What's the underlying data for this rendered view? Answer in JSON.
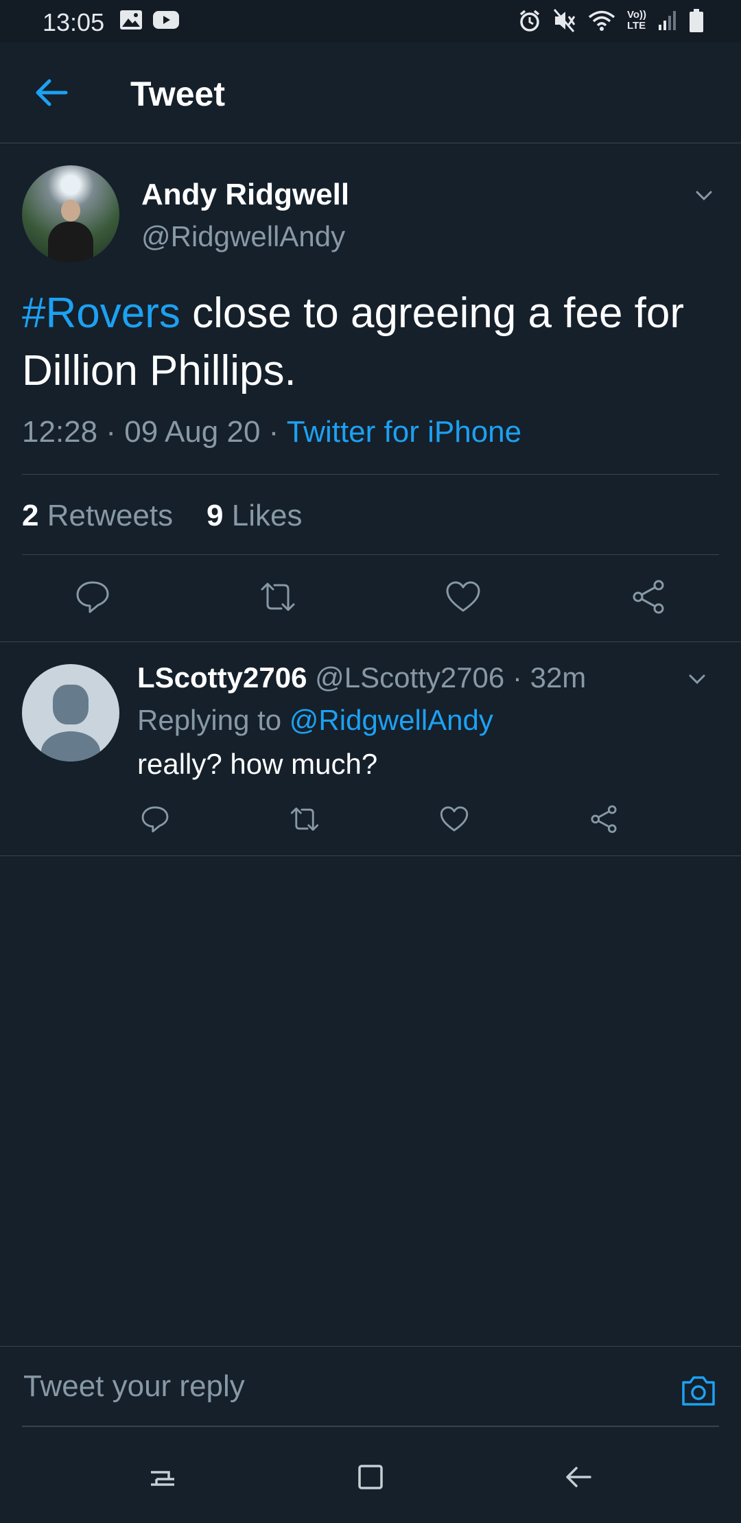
{
  "status_bar": {
    "time": "13:05",
    "lte_label": "LTE",
    "volte_label": "Vo))"
  },
  "header": {
    "title": "Tweet"
  },
  "tweet": {
    "author_name": "Andy Ridgwell",
    "author_handle": "@RidgwellAndy",
    "text_hashtag": "#Rovers",
    "text_rest": " close to agreeing a fee for Dillion Phillips.",
    "time": "12:28",
    "separator": " · ",
    "date": "09 Aug 20",
    "source": "Twitter for iPhone",
    "retweets_count": "2",
    "retweets_label": "Retweets",
    "likes_count": "9",
    "likes_label": "Likes"
  },
  "reply": {
    "name": "LScotty2706",
    "handle": "@LScotty2706",
    "age": "· 32m",
    "replying_prefix": "Replying to",
    "replying_mention": "@RidgwellAndy",
    "text": "really? how much?"
  },
  "composer": {
    "placeholder": "Tweet your reply"
  },
  "colors": {
    "background": "#15202b",
    "accent": "#1da1f2",
    "secondary_text": "#8899a6",
    "divider": "#38444d"
  },
  "icons": [
    "back-arrow-icon",
    "chevron-down-icon",
    "reply-icon",
    "retweet-icon",
    "like-icon",
    "share-icon",
    "camera-icon",
    "recents-icon",
    "home-icon",
    "back-icon"
  ]
}
